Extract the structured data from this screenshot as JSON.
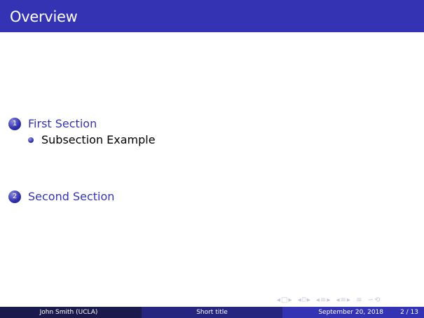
{
  "frame": {
    "title": "Overview"
  },
  "toc": {
    "sections": [
      {
        "number": "1",
        "label": "First Section",
        "subsections": [
          "Subsection Example"
        ]
      },
      {
        "number": "2",
        "label": "Second Section",
        "subsections": []
      }
    ]
  },
  "navigation": {
    "icons": [
      "nav-frame-left",
      "nav-frame-right",
      "nav-subsection-left",
      "nav-subsection-right",
      "nav-section-left",
      "nav-section-right",
      "nav-align",
      "nav-search"
    ],
    "symbols": [
      "◂",
      "□",
      "▸",
      "◂",
      "⌼",
      "▸",
      "◂",
      "≡",
      "▸",
      "◂",
      "≡",
      "▸",
      "≡",
      "∽",
      "⟲"
    ]
  },
  "footline": {
    "author": "John Smith  (UCLA)",
    "short_title": "Short title",
    "date": "September 20, 2018",
    "page": "2 / 13"
  },
  "colors": {
    "title_bar": "#3333b3",
    "footer_left": "#1a1a4d",
    "footer_mid": "#262680",
    "footer_right": "#3333b3",
    "section_text": "#3333b3"
  }
}
